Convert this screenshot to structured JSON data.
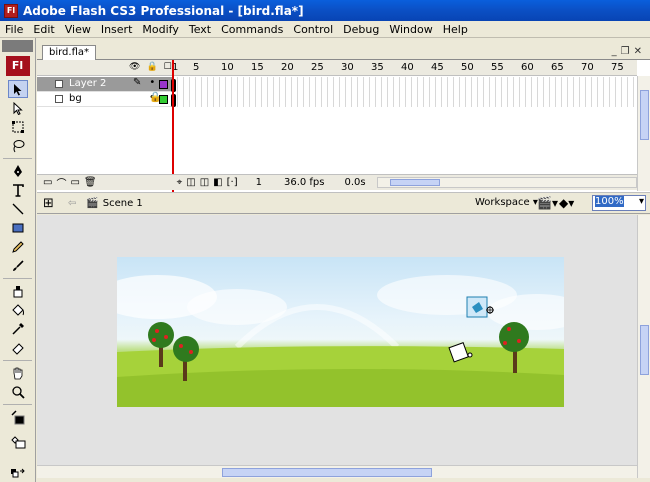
{
  "window": {
    "title": "Adobe Flash CS3 Professional - [bird.fla*]",
    "app_icon": "Fl"
  },
  "menu": [
    "File",
    "Edit",
    "View",
    "Insert",
    "Modify",
    "Text",
    "Commands",
    "Control",
    "Debug",
    "Window",
    "Help"
  ],
  "toolbox": {
    "logo": "Fl"
  },
  "document": {
    "tab": "bird.fla*"
  },
  "timeline": {
    "frame_numbers": [
      "1",
      "5",
      "10",
      "15",
      "20",
      "25",
      "30",
      "35",
      "40",
      "45",
      "50",
      "55",
      "60",
      "65",
      "70",
      "75"
    ],
    "layers": [
      {
        "name": "Layer 2",
        "selected": true,
        "color": "#9933cc"
      },
      {
        "name": "bg",
        "selected": false,
        "color": "#33cc33"
      }
    ],
    "footer": {
      "current_frame": "1",
      "fps": "36.0 fps",
      "time": "0.0s"
    }
  },
  "editbar": {
    "scene": "Scene 1",
    "workspace": "Workspace",
    "zoom": "100%"
  },
  "icons": [
    "app-flash-icon",
    "arrow-icon",
    "subselect-icon",
    "free-transform-icon",
    "lasso-icon",
    "pen-icon",
    "text-icon",
    "line-icon",
    "rectangle-icon",
    "pencil-icon",
    "brush-icon",
    "ink-bottle-icon",
    "paint-bucket-icon",
    "eyedropper-icon",
    "eraser-icon",
    "hand-icon",
    "zoom-icon",
    "stroke-color-icon",
    "fill-color-icon",
    "eye-icon",
    "lock-icon",
    "outline-icon",
    "edit-scene-icon",
    "edit-symbol-icon"
  ]
}
